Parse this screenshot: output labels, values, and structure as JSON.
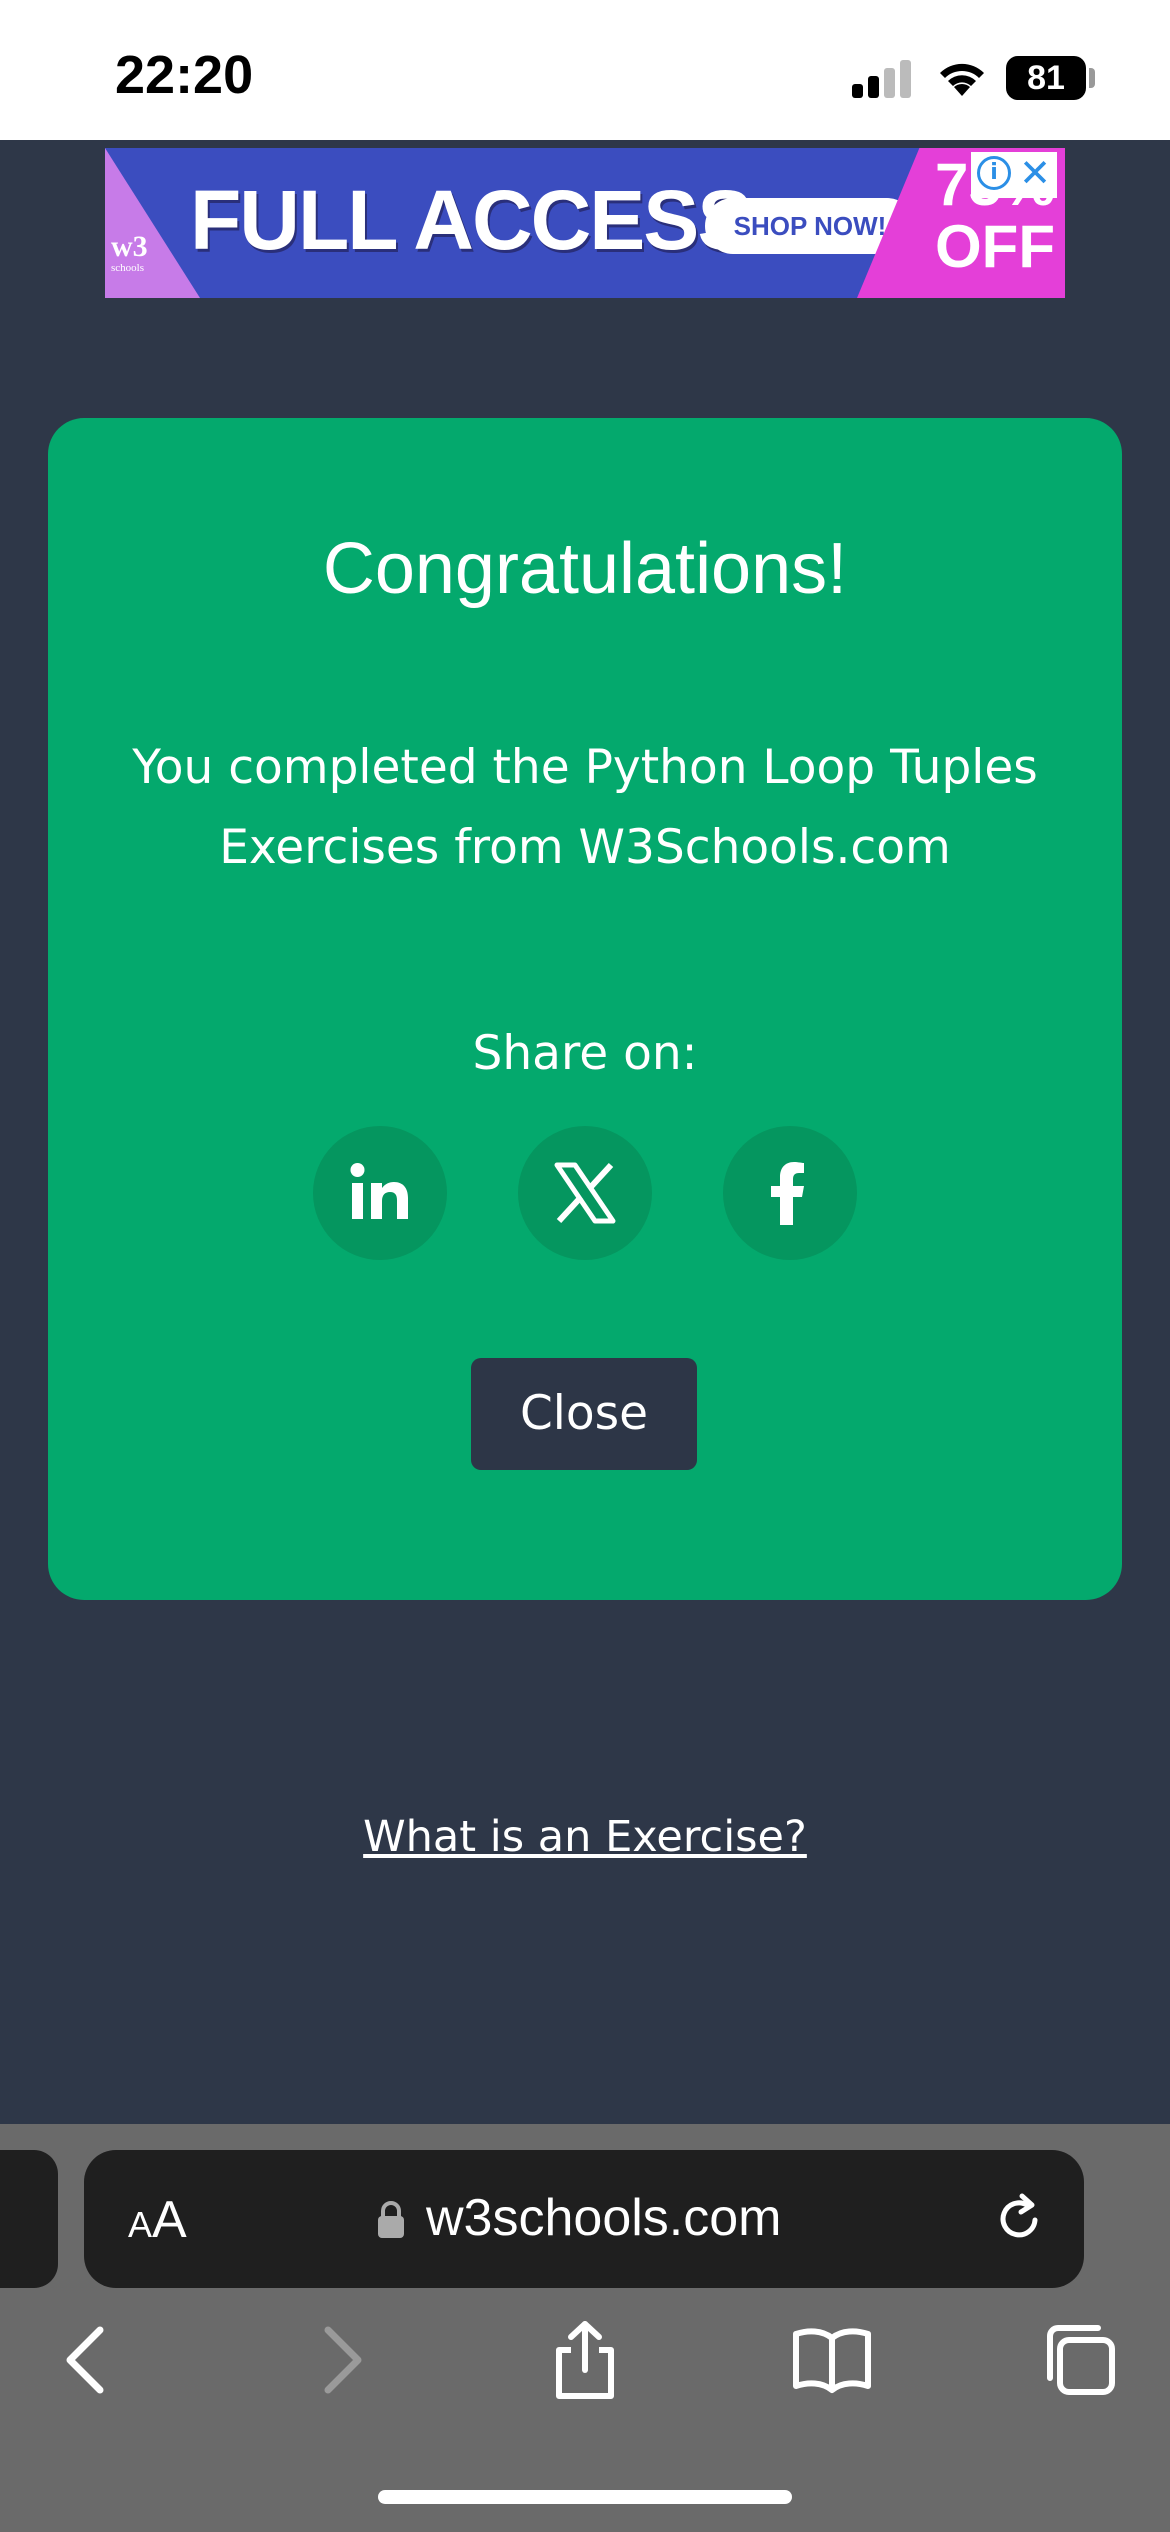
{
  "status_bar": {
    "time": "22:20",
    "battery": "81"
  },
  "ad": {
    "title": "FULL ACCESS",
    "shop_label": "SHOP NOW!",
    "discount": "75%",
    "discount_suffix": "OFF",
    "logo_text": "w3",
    "logo_sub": "schools"
  },
  "card": {
    "title": "Congratulations!",
    "message": "You completed the Python Loop Tuples Exercises from W3Schools.com",
    "share_label": "Share on:",
    "share_icons": [
      "linkedin-icon",
      "x-icon",
      "facebook-icon"
    ],
    "close_label": "Close",
    "bg_color": "#04a96d"
  },
  "exercise_link": "What is an Exercise?",
  "browser": {
    "text_size_label_small": "A",
    "text_size_label_large": "A",
    "url": "w3schools.com"
  },
  "colors": {
    "page_bg": "#2e3748",
    "button_bg": "#2d3647"
  }
}
